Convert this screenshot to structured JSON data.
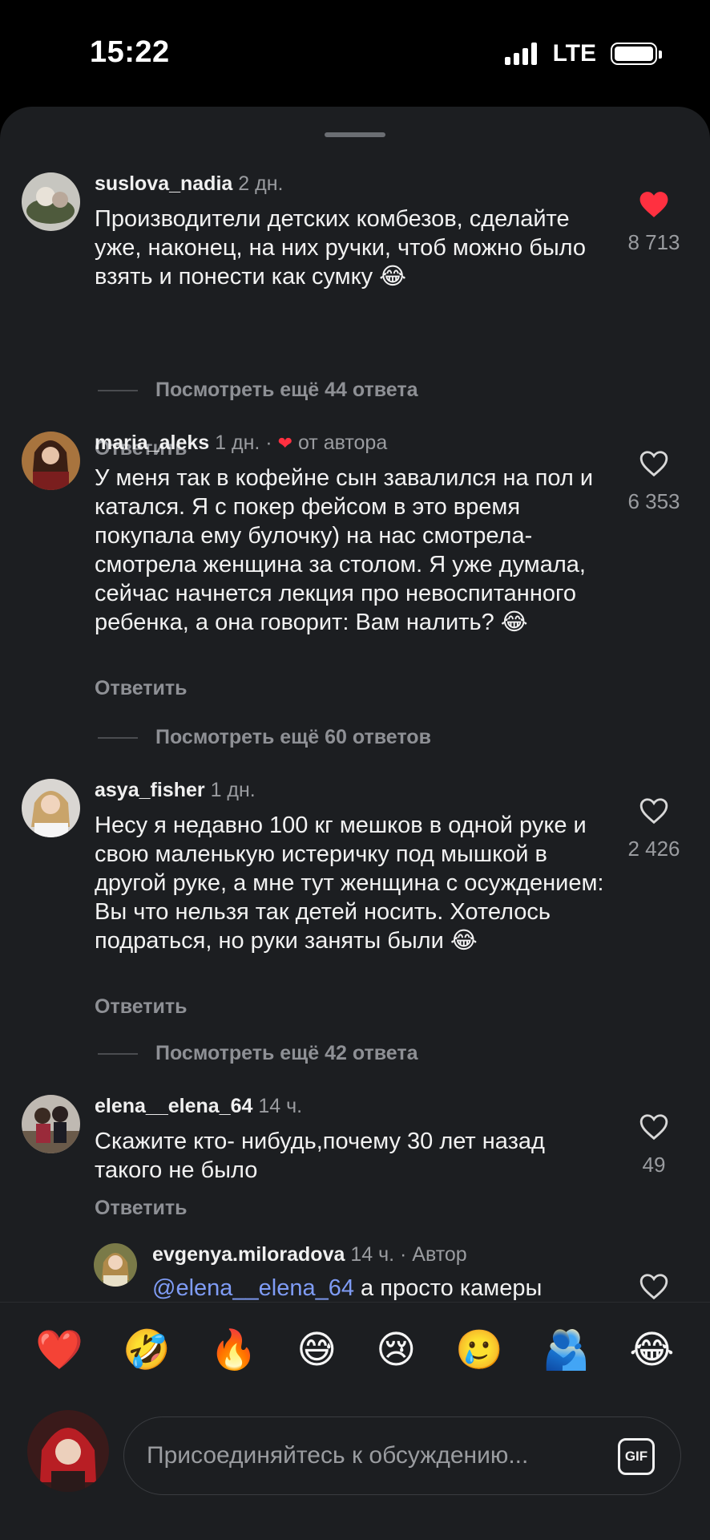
{
  "status": {
    "time": "15:22",
    "network": "LTE"
  },
  "comments": [
    {
      "username": "suslova_nadia",
      "time": "2 дн.",
      "text": "Производители детских комбезов, сделайте уже, наконец, на них ручки, чтоб можно было взять и понести как сумку 😂",
      "likes": "8 713",
      "liked": true,
      "reply_label": "Ответить",
      "more_replies": "Посмотреть ещё 44 ответа"
    },
    {
      "username": "maria_aleks",
      "time": "1 дн. ·",
      "author_badge": "от автора",
      "text": "У меня так в кофейне сын завалился на пол и катался. Я с покер фейсом в это время покупала ему булочку) на нас смотрела-смотрела женщина за столом. Я уже думала, сейчас начнется лекция про невоспитанного ребенка, а она говорит: Вам налить? 😂",
      "likes": "6 353",
      "liked": false,
      "reply_label": "Ответить",
      "more_replies": "Посмотреть ещё 60 ответов"
    },
    {
      "username": "asya_fisher",
      "time": "1 дн.",
      "text": "Несу я недавно 100 кг мешков в одной руке и свою маленькую истеричку под мышкой в другой руке, а мне тут женщина с осуждением: Вы что нельзя так детей носить. Хотелось подраться, но руки заняты были 😂",
      "likes": "2 426",
      "liked": false,
      "reply_label": "Ответить",
      "more_replies": "Посмотреть ещё 42 ответа"
    },
    {
      "username": "elena__elena_64",
      "time": "14 ч.",
      "text": "Скажите кто- нибудь,почему 30 лет назад такого не было",
      "likes": "49",
      "liked": false,
      "reply_label": "Ответить"
    }
  ],
  "reply": {
    "username": "evgenya.miloradova",
    "time": "14 ч. · Автор",
    "mention": "@elena__elena_64",
    "text": " а просто камеры"
  },
  "emoji_bar": [
    "❤️",
    "🤣",
    "🔥",
    "😅",
    "😢",
    "🥲",
    "🫂",
    "😂"
  ],
  "composer": {
    "placeholder": "Присоединяйтесь к обсуждению...",
    "gif_label": "GIF"
  },
  "colors": {
    "background": "#1c1e21",
    "like_red": "#ff3040",
    "mention_blue": "#7f9cf5",
    "muted_text": "#9a9ca0"
  },
  "icons": [
    "heart-outline-icon",
    "heart-filled-icon",
    "gif-icon",
    "signal-icon",
    "battery-icon"
  ]
}
